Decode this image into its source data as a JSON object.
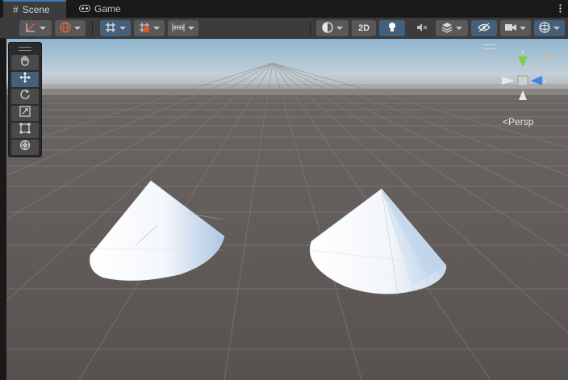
{
  "tabs": [
    {
      "label": "Scene",
      "icon": "hash-icon",
      "active": true
    },
    {
      "label": "Game",
      "icon": "gamepad-icon",
      "active": false
    }
  ],
  "menu_icon": "kebab-menu-icon",
  "toolbar": {
    "draw_mode_icon": "draw-mode-icon",
    "global_icon": "globe-icon",
    "grid_icon": "grid-snap-icon",
    "snap_icon": "increment-snap-icon",
    "ruler_icon": "ruler-icon",
    "render_mode_icon": "sphere-shading-icon",
    "two_d_label": "2D",
    "lighting_icon": "lightbulb-icon",
    "audio_icon": "audio-mute-icon",
    "effects_icon": "effects-stack-icon",
    "visibility_icon": "hidden-eye-icon",
    "camera_icon": "camera-icon",
    "gizmos_icon": "gizmo-globe-icon"
  },
  "tools": [
    {
      "name": "hand-tool",
      "icon": "hand-icon",
      "active": false
    },
    {
      "name": "move-tool",
      "icon": "move-arrows-icon",
      "active": true
    },
    {
      "name": "rotate-tool",
      "icon": "rotate-icon",
      "active": false
    },
    {
      "name": "scale-tool",
      "icon": "scale-icon",
      "active": false
    },
    {
      "name": "rect-tool",
      "icon": "rect-icon",
      "active": false
    },
    {
      "name": "transform-tool",
      "icon": "transform-icon",
      "active": false
    }
  ],
  "gizmo": {
    "projection_label": "Persp",
    "axis_y": "y",
    "axis_x": "x"
  },
  "colors": {
    "accent": "#3a79bb",
    "active_button": "#46607c",
    "ground": "#5a5553",
    "sky_top": "#8fb4cf",
    "axis_y": "#7bd33b",
    "axis_x": "#3e86e5"
  }
}
